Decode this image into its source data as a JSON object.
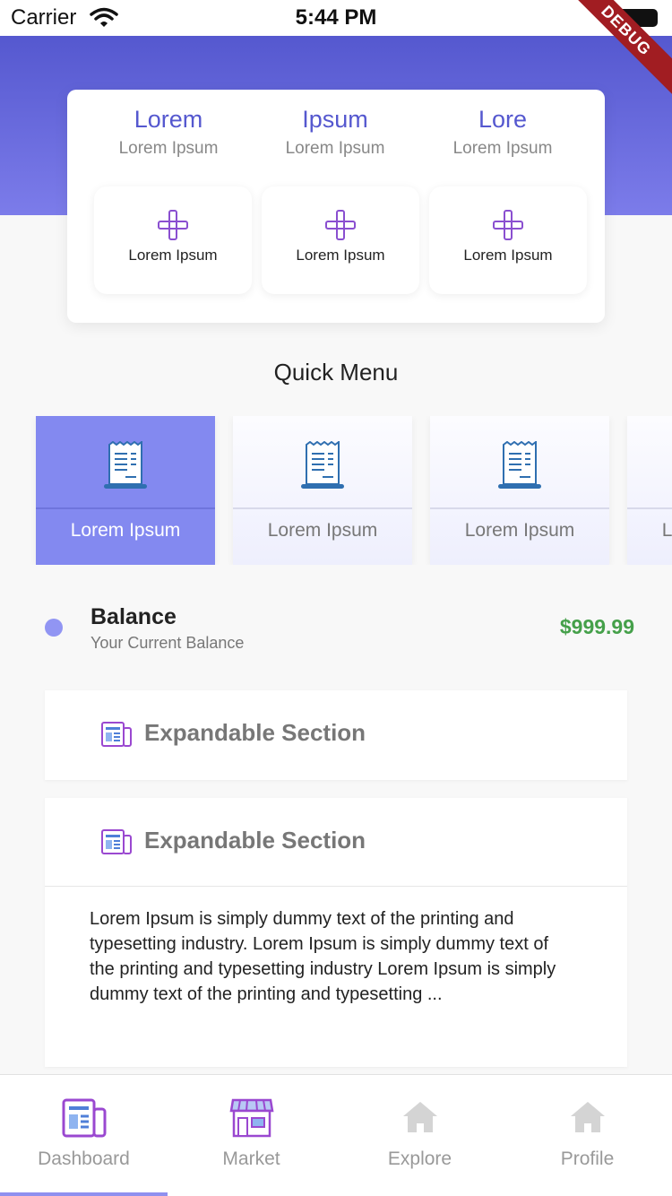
{
  "status_bar": {
    "carrier": "Carrier",
    "time": "5:44 PM"
  },
  "debug_label": "DEBUG",
  "summary": {
    "stats": [
      {
        "title": "Lorem",
        "subtitle": "Lorem Ipsum"
      },
      {
        "title": "Ipsum",
        "subtitle": "Lorem Ipsum"
      },
      {
        "title": "Lore",
        "subtitle": "Lorem Ipsum"
      }
    ],
    "actions": [
      {
        "label": "Lorem Ipsum",
        "icon": "plus-icon"
      },
      {
        "label": "Lorem Ipsum",
        "icon": "plus-icon"
      },
      {
        "label": "Lorem Ipsum",
        "icon": "plus-icon"
      }
    ]
  },
  "quick_menu": {
    "title": "Quick Menu",
    "items": [
      {
        "label": "Lorem Ipsum",
        "icon": "receipt-icon",
        "active": true
      },
      {
        "label": "Lorem Ipsum",
        "icon": "receipt-icon",
        "active": false
      },
      {
        "label": "Lorem Ipsum",
        "icon": "receipt-icon",
        "active": false
      },
      {
        "label": "Lorem Ipsum",
        "icon": "receipt-icon",
        "active": false
      }
    ]
  },
  "balance": {
    "title": "Balance",
    "subtitle": "Your Current Balance",
    "amount": "$999.99"
  },
  "sections": [
    {
      "title": "Expandable Section",
      "expanded": false,
      "body": ""
    },
    {
      "title": "Expandable Section",
      "expanded": true,
      "body": "Lorem Ipsum is simply dummy text of the printing and typesetting industry. Lorem Ipsum is simply dummy text of the printing and typesetting industry Lorem Ipsum is simply dummy text of the printing and typesetting ..."
    }
  ],
  "bottom_nav": {
    "items": [
      {
        "label": "Dashboard",
        "icon": "dashboard-icon",
        "active": true
      },
      {
        "label": "Market",
        "icon": "market-icon",
        "active": false
      },
      {
        "label": "Explore",
        "icon": "home-icon",
        "active": false
      },
      {
        "label": "Profile",
        "icon": "home-icon",
        "active": false
      }
    ]
  },
  "colors": {
    "primary": "#5558cf",
    "accent": "#8389f0",
    "amount": "#45a04a",
    "debug": "#a11d22"
  }
}
